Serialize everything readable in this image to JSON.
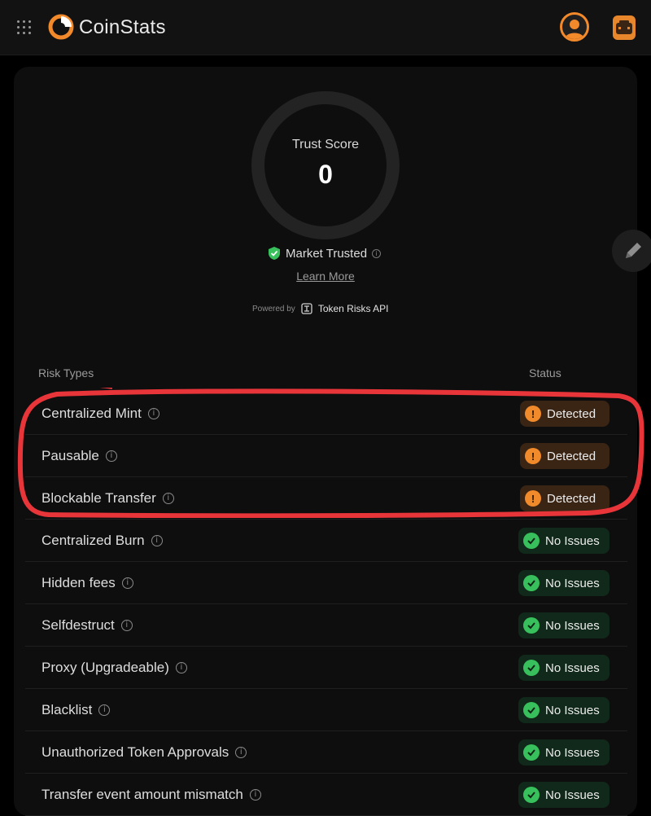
{
  "header": {
    "brand": "CoinStats",
    "icons": {
      "apps": "apps-grid-icon",
      "logo": "coinstats-logo-icon",
      "profile": "user-avatar-icon",
      "portfolio": "portfolio-briefcase-icon"
    },
    "accent": "#f2892a"
  },
  "trust": {
    "label": "Trust Score",
    "value": "0",
    "badge": "Market Trusted",
    "learn_more": "Learn More",
    "powered_by": "Powered by",
    "api_name": "Token Risks API"
  },
  "table": {
    "col_risk": "Risk Types",
    "col_status": "Status",
    "rows": [
      {
        "name": "Centralized Mint",
        "status": "Detected"
      },
      {
        "name": "Pausable",
        "status": "Detected"
      },
      {
        "name": "Blockable Transfer",
        "status": "Detected"
      },
      {
        "name": "Centralized Burn",
        "status": "No Issues"
      },
      {
        "name": "Hidden fees",
        "status": "No Issues"
      },
      {
        "name": "Selfdestruct",
        "status": "No Issues"
      },
      {
        "name": "Proxy (Upgradeable)",
        "status": "No Issues"
      },
      {
        "name": "Blacklist",
        "status": "No Issues"
      },
      {
        "name": "Unauthorized Token Approvals",
        "status": "No Issues"
      },
      {
        "name": "Transfer event amount mismatch",
        "status": "No Issues"
      }
    ]
  },
  "colors": {
    "detected": "#f08a2a",
    "ok": "#38c05c",
    "annotation": "#e8353a"
  }
}
